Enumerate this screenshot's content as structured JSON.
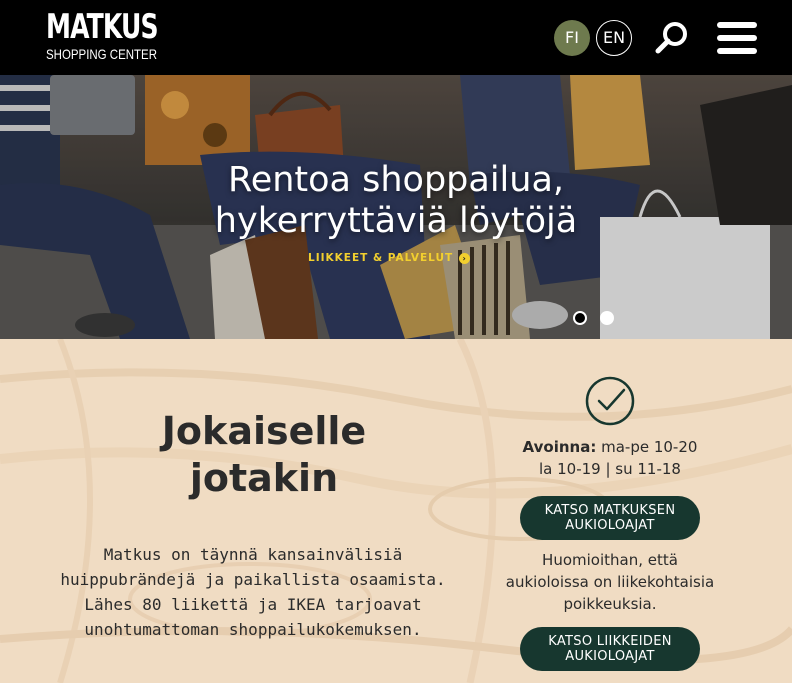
{
  "header": {
    "logo_main": "MATKUS",
    "logo_sub": "SHOPPING CENTER",
    "lang_fi": "FI",
    "lang_en": "EN",
    "search_icon": "search-icon",
    "menu_icon": "hamburger-menu-icon"
  },
  "hero": {
    "title_line1": "Rentoa shoppailua,",
    "title_line2": "hykerryttäviä löytöjä",
    "link_label": "LIIKKEET & PALVELUT",
    "link_icon": "arrow-circle-icon",
    "slides": 2,
    "active_slide": 1
  },
  "main": {
    "headline_line1": "Jokaiselle",
    "headline_line2": "jotakin",
    "intro": "Matkus on täynnä kansainvälisiä huippubrändejä ja paikallista osaamista. Lähes 80 liikettä ja IKEA tarjoavat unohtumattoman shoppailukokemuksen.",
    "check_icon": "checkmark-circle-icon",
    "hours_label": "Avoinna:",
    "hours_line1": "ma-pe 10-20",
    "hours_line2": "la 10-19 | su 11-18",
    "button1_line1": "KATSO MATKUKSEN",
    "button1_line2": "AUKIOLOAJAT",
    "note": "Huomioithan, että aukioloissa on liikekohtaisia poikkeuksia.",
    "button2_line1": "KATSO LIIKKEIDEN",
    "button2_line2": "AUKIOLOAJAT"
  },
  "colors": {
    "header_bg": "#000000",
    "lang_fi_active": "#6e7a4e",
    "accent_yellow": "#f2cf2e",
    "button_bg": "#17372f",
    "wood_bg": "#f0dcc3"
  }
}
